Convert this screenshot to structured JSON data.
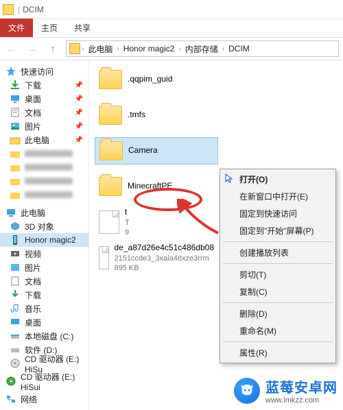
{
  "title": {
    "seg1": "DCIM"
  },
  "ribbon": {
    "file": "文件",
    "home": "主页",
    "share": "共享"
  },
  "breadcrumb": {
    "b0": "此电脑",
    "b1": "Honor magic2",
    "b2": "内部存储",
    "b3": "DCIM"
  },
  "sidebar": {
    "quick": "快速访问",
    "downloads": "下载",
    "desktop": "桌面",
    "docs": "文档",
    "pics": "图片",
    "thispc_top": "此电脑",
    "thispc": "此电脑",
    "obj3d": "3D 对象",
    "honor": "Honor magic2",
    "video": "视频",
    "pics2": "图片",
    "docs2": "文档",
    "downloads2": "下载",
    "music": "音乐",
    "desktop2": "桌面",
    "cdrive": "本地磁盘 (C:)",
    "ddrive": "软件 (D:)",
    "cddrive": "CD 驱动器 (E:) HiSu",
    "cddrive2": "CD 驱动器 (E:) HiSui",
    "network": "网络"
  },
  "items": {
    "i0": {
      "name": ".qqpim_guid"
    },
    "i1": {
      "name": ".tmfs"
    },
    "i2": {
      "name": "Camera"
    },
    "i3": {
      "name": "MinecraftPE"
    },
    "i4": {
      "name": "t",
      "line2": "T",
      "line3": "9"
    },
    "i5": {
      "name": "de_a87d26e4c51c486db08",
      "line2": "2151ccde3_3xaia48xze3rrm",
      "line3": "895 KB"
    }
  },
  "menu": {
    "open": "打开(O)",
    "newwin": "在新窗口中打开(E)",
    "pinquick": "固定到快速访问",
    "pinstart": "固定到\"开始\"屏幕(P)",
    "playlist": "创建播放列表",
    "cut": "剪切(T)",
    "copy": "复制(C)",
    "delete": "删除(D)",
    "rename": "重命名(M)",
    "props": "属性(R)"
  },
  "watermark": {
    "title": "蓝莓安卓网",
    "sub": "www.lmkzz.com"
  }
}
